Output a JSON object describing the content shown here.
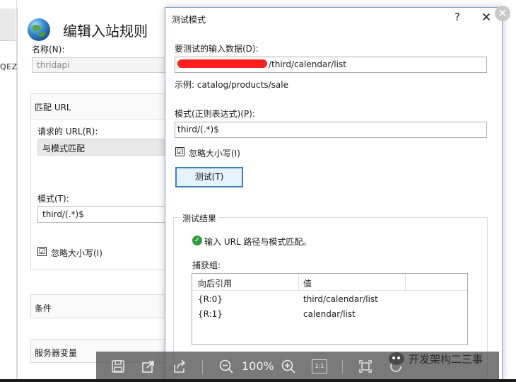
{
  "edge": {
    "fragment_text": "QEZ"
  },
  "background_panel": {
    "title": "编辑入站规则",
    "name_label": "名称(N):",
    "name_value": "thridapi",
    "match_url_header": "匹配 URL",
    "requested_url_label": "请求的 URL(R):",
    "requested_url_value": "与模式匹配",
    "pattern_label": "模式(T):",
    "pattern_value": "third/(.*)$",
    "ignore_case_label": "忽略大小写(I)",
    "ignore_case_checked": "☑",
    "conditions_label": "条件",
    "server_vars_label": "服务器变量"
  },
  "dialog": {
    "title": "测试模式",
    "help_glyph": "?",
    "close_glyph": "✕",
    "input_label": "要测试的输入数据(D):",
    "input_value_visible": "/third/calendar/list",
    "example_text": "示例: catalog/products/sale",
    "pattern_label": "模式(正则表达式)(P):",
    "pattern_value": "third/(.*)$",
    "ignore_case_label": "忽略大小写(I)",
    "test_button_label": "测试(T)",
    "results_legend": "测试结果",
    "result_message": "输入 URL 路径与模式匹配。",
    "capture_groups_label": "捕获组:",
    "capture_table": {
      "columns": [
        "向后引用",
        "值"
      ],
      "rows": [
        [
          "{R:0}",
          "third/calendar/list"
        ],
        [
          "{R:1}",
          "calendar/list"
        ]
      ]
    }
  },
  "viewer_toolbar": {
    "zoom_level": "100%",
    "one_to_one_label": "1:1",
    "close_glyph": "✕"
  },
  "watermark": {
    "text": "开发架构二三事"
  },
  "colors": {
    "dialog_border": "#7a9ec7",
    "button_border": "#3c7fc1",
    "button_fill": "#e5f1fb",
    "success_green": "#2f9e3a",
    "redaction_red": "#ff1f1f"
  },
  "icons": {
    "app_icon": "globe-icon",
    "result_icon": "check-circle-icon",
    "toolbar": [
      "save-icon",
      "open-external-icon",
      "share-icon",
      "zoom-out-icon",
      "zoom-in-icon",
      "actual-size-icon",
      "fit-screen-icon",
      "rotate-icon"
    ]
  }
}
